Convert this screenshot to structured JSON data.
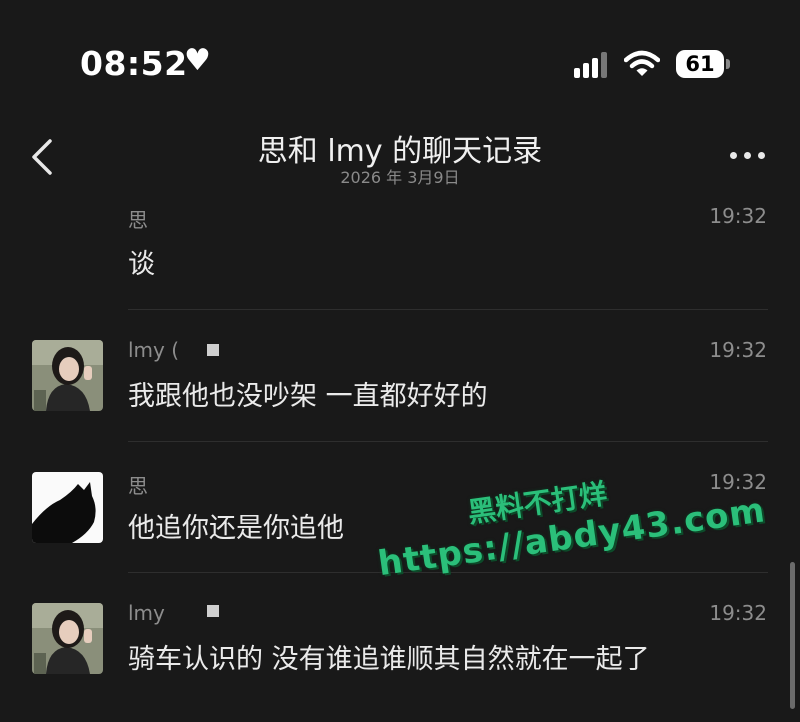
{
  "status": {
    "time": "08:52",
    "battery": "61"
  },
  "header": {
    "title": "思和 lmy 的聊天记录",
    "subtitle": "2026 年 3月9日"
  },
  "messages": [
    {
      "sender": "思",
      "time": "19:32",
      "text": "谈"
    },
    {
      "sender": "lmy (",
      "time": "19:32",
      "text": "我跟他也没吵架 一直都好好的"
    },
    {
      "sender": "思",
      "time": "19:32",
      "text": "他追你还是你追他"
    },
    {
      "sender": "lmy",
      "time": "19:32",
      "text": "骑车认识的 没有谁追谁顺其自然就在一起了"
    }
  ],
  "watermark": {
    "line1": "黑料不打烊",
    "line2": "https://abdy43.com"
  },
  "colors": {
    "background": "#191919",
    "meta_text": "#8d8d8d",
    "watermark": "#2bbf7a"
  }
}
